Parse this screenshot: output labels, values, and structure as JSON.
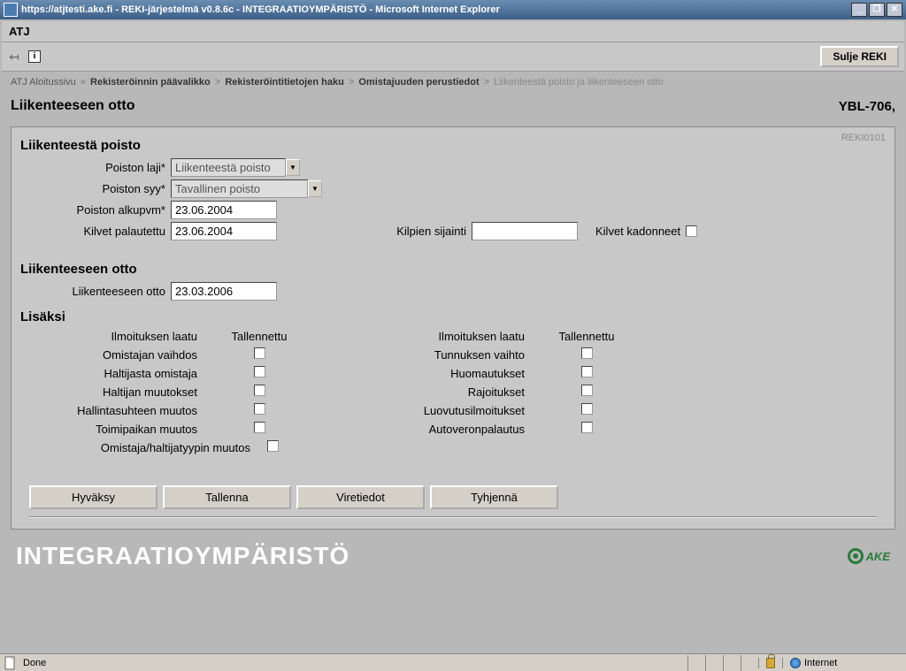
{
  "window": {
    "title": "https://atjtesti.ake.fi - REKI-järjestelmä v0.8.6c - INTEGRAATIOYMPÄRISTÖ - Microsoft Internet Explorer"
  },
  "menubar": {
    "app": "ATJ"
  },
  "toolbar": {
    "close_reki": "Sulje REKI"
  },
  "breadcrumb": {
    "items": [
      "ATJ Aloitussivu",
      "Rekisteröinnin päävalikko",
      "Rekisteröintitietojen haku",
      "Omistajuuden perustiedot",
      "Liikenteestä poisto ja liikenteeseen otto"
    ]
  },
  "page": {
    "title": "Liikenteeseen otto",
    "plate": "YBL-706,"
  },
  "panel": {
    "code": "REKI0101"
  },
  "removal": {
    "title": "Liikenteestä poisto",
    "type_label": "Poiston laji*",
    "type_value": "Liikenteestä poisto",
    "reason_label": "Poiston syy*",
    "reason_value": "Tavallinen poisto",
    "start_label": "Poiston alkupvm*",
    "start_value": "23.06.2004",
    "plates_returned_label": "Kilvet palautettu",
    "plates_returned_value": "23.06.2004",
    "plates_location_label": "Kilpien sijainti",
    "plates_location_value": "",
    "plates_lost_label": "Kilvet kadonneet"
  },
  "intake": {
    "title": "Liikenteeseen otto",
    "date_label": "Liikenteeseen otto",
    "date_value": "23.03.2006"
  },
  "extras": {
    "title": "Lisäksi",
    "col_quality": "Ilmoituksen laatu",
    "col_saved": "Tallennettu",
    "left": [
      "Omistajan vaihdos",
      "Haltijasta omistaja",
      "Haltijan muutokset",
      "Hallintasuhteen muutos",
      "Toimipaikan muutos",
      "Omistaja/haltijatyypin muutos"
    ],
    "right": [
      "Tunnuksen vaihto",
      "Huomautukset",
      "Rajoitukset",
      "Luovutusilmoitukset",
      "Autoveronpalautus"
    ]
  },
  "buttons": {
    "approve": "Hyväksy",
    "save": "Tallenna",
    "details": "Viretiedot",
    "clear": "Tyhjennä"
  },
  "footer": {
    "env": "INTEGRAATIOYMPÄRISTÖ",
    "brand": "AKE"
  },
  "status": {
    "done": "Done",
    "zone": "Internet"
  }
}
